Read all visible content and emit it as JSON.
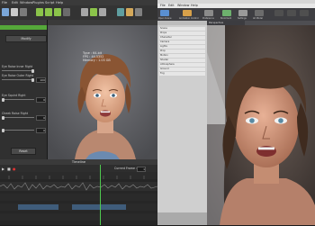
{
  "left_app": {
    "menu": [
      "File",
      "Edit",
      "Window",
      "Plugins",
      "Script",
      "Help"
    ],
    "panel": {
      "tab_label": "Modify",
      "sliders": [
        {
          "label": "Eye Raise Inner Right",
          "value": ""
        },
        {
          "label": "Eye Raise Outer Right",
          "value": "100"
        },
        {
          "label": "Eye Squint Right",
          "value": "0"
        },
        {
          "label": "Cheek Raise Right",
          "value": "0"
        },
        {
          "label": "",
          "value": "0"
        }
      ],
      "reset_label": "Reset"
    },
    "viewport": {
      "info_lines": [
        "Type : 64-bit",
        "FPS : 44.5352",
        "Memory : 1.03 GB"
      ]
    },
    "timeline": {
      "title": "Timeline",
      "current_frame_label": "Current Frame :",
      "current_frame_value": "1"
    }
  },
  "right_app": {
    "menu": [
      "File",
      "Edit",
      "Window",
      "Help"
    ],
    "toolbar": [
      {
        "label": "Open Scene",
        "color": "#5a8fd1"
      },
      {
        "label": "Animation Control",
        "color": "#d7a04a"
      },
      {
        "label": "Preference",
        "color": "#8a8a8a"
      },
      {
        "label": "Bookmark",
        "color": "#6db06d"
      },
      {
        "label": "Settings",
        "color": "#9a9a9a"
      },
      {
        "label": "All Model",
        "color": "#6c6c6c"
      }
    ],
    "sidebar_rows": [
      "Scene",
      "Props",
      "Character",
      "Camera",
      "Lights",
      "Prop",
      "Motion",
      "Shader",
      "Atmosphere",
      "Ground",
      "Fog"
    ],
    "viewport_tab": "Perspective"
  }
}
